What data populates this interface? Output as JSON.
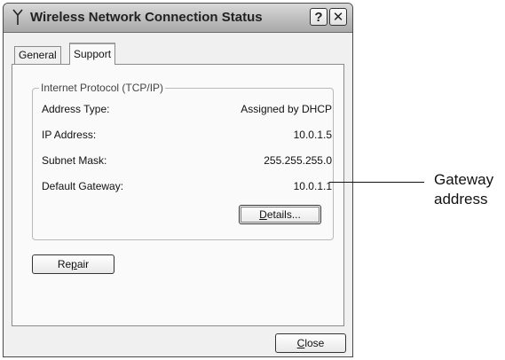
{
  "window": {
    "title": "Wireless Network Connection Status",
    "help_button": "?",
    "close_glyph": "✕"
  },
  "tabs": [
    {
      "label": "General",
      "active": false
    },
    {
      "label": "Support",
      "active": true
    }
  ],
  "group": {
    "legend": "Internet Protocol (TCP/IP)",
    "rows": [
      {
        "label": "Address Type:",
        "value": "Assigned by DHCP"
      },
      {
        "label": "IP Address:",
        "value": "10.0.1.5"
      },
      {
        "label": "Subnet Mask:",
        "value": "255.255.255.0"
      },
      {
        "label": "Default Gateway:",
        "value": "10.0.1.1"
      }
    ],
    "details_button": {
      "pre": "",
      "accel": "D",
      "post": "etails..."
    }
  },
  "repair_button": {
    "pre": "Re",
    "accel": "p",
    "post": "air"
  },
  "close_button": {
    "pre": "",
    "accel": "C",
    "post": "lose"
  },
  "callout": {
    "line1": "Gateway",
    "line2": "address"
  },
  "icons": {
    "title": "wireless-antenna-icon"
  }
}
